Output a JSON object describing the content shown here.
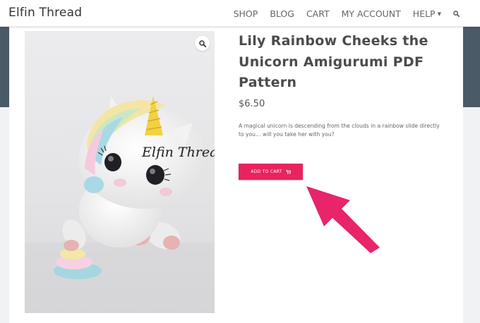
{
  "site": {
    "brand": "Elfin Thread"
  },
  "nav": {
    "items": [
      {
        "label": "SHOP"
      },
      {
        "label": "BLOG"
      },
      {
        "label": "CART"
      },
      {
        "label": "MY ACCOUNT"
      },
      {
        "label": "HELP"
      }
    ],
    "search_icon": "search-icon"
  },
  "product": {
    "title": "Lily Rainbow Cheeks the Unicorn Amigurumi PDF Pattern",
    "price": "$6.50",
    "description": "A magical unicorn is descending from the clouds in a rainbow slide directly to you… will you take her with you?",
    "add_to_cart_label": "ADD TO CART",
    "image_watermark": "Elfin Thread",
    "image_alt": "Crocheted white unicorn amigurumi with rainbow pastel mane and golden horn"
  },
  "colors": {
    "accent": "#e8245f",
    "hero_band": "#4a5a66",
    "arrow": "#e8246a"
  },
  "icons": [
    "search-icon",
    "zoom-icon",
    "cart-icon",
    "caret-down-icon",
    "pointer-arrow-icon"
  ]
}
